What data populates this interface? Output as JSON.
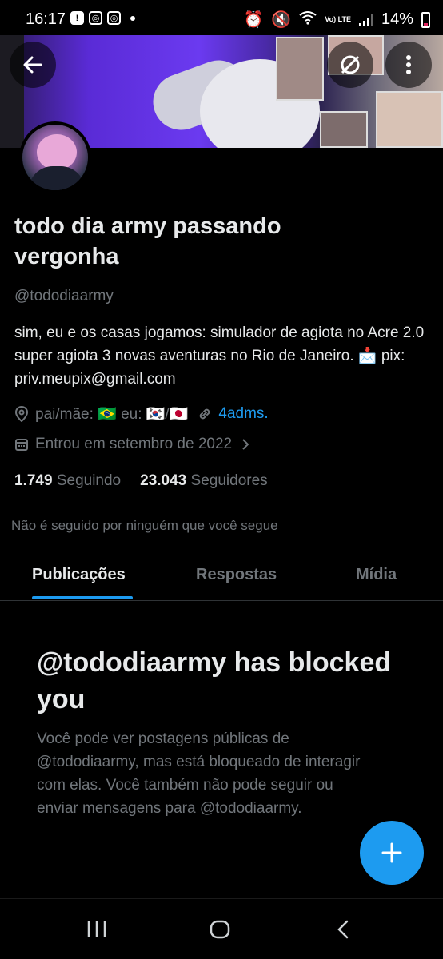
{
  "status_bar": {
    "time": "16:17",
    "battery": "14%",
    "net": "Vo) LTE"
  },
  "header": {
    "back_icon": "arrow-left-icon",
    "grok_icon": "grok-icon",
    "more_icon": "more-vertical-icon"
  },
  "profile": {
    "name": "todo dia army passando vergonha",
    "handle": "@tododiaarmy",
    "bio": "sim, eu e os casas jogamos: simulador de agiota no Acre 2.0 super agiota 3 novas aventuras no Rio de Janeiro. 📩 pix: priv.meupix@gmail.com",
    "location": "pai/mãe: 🇧🇷 eu: 🇰🇷/🇯🇵",
    "website": "4adms.",
    "joined": "Entrou em setembro de 2022",
    "following_count": "1.749",
    "following_label": "Seguindo",
    "followers_count": "23.043",
    "followers_label": "Seguidores",
    "not_followed": "Não é seguido por ninguém que você segue"
  },
  "tabs": [
    {
      "label": "Publicações",
      "active": true
    },
    {
      "label": "Respostas",
      "active": false
    },
    {
      "label": "Mídia",
      "active": false
    }
  ],
  "blocked": {
    "title": "@tododiaarmy has blocked you",
    "body": "Você pode ver postagens públicas de @tododiaarmy, mas está bloqueado de interagir com elas. Você também não pode seguir ou enviar mensagens para @tododiaarmy."
  },
  "colors": {
    "accent": "#1d9bf0",
    "muted": "#71767b",
    "text": "#e7e9ea",
    "bg": "#000000"
  }
}
